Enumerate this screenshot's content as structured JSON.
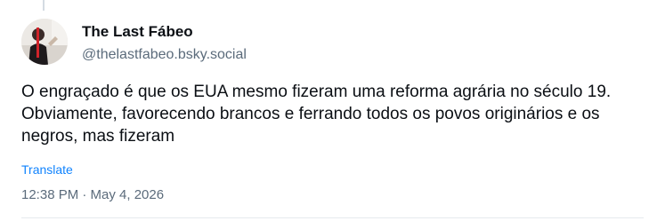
{
  "post": {
    "author": {
      "display_name": "The Last Fábeo",
      "handle": "@thelastfabeo.bsky.social",
      "avatar_icon": "user-avatar-photo"
    },
    "text": "O engraçado é que os EUA mesmo fizeram uma reforma agrária no século 19. Obviamente, favorecendo brancos e ferrando todos os povos originários e os negros, mas fizeram",
    "translate_label": "Translate",
    "timestamp": "12:38 PM · May 4, 2026"
  },
  "colors": {
    "text_primary": "#0b0f14",
    "text_secondary": "#5b6b7b",
    "link": "#1083fe",
    "divider": "#e6eaee"
  }
}
